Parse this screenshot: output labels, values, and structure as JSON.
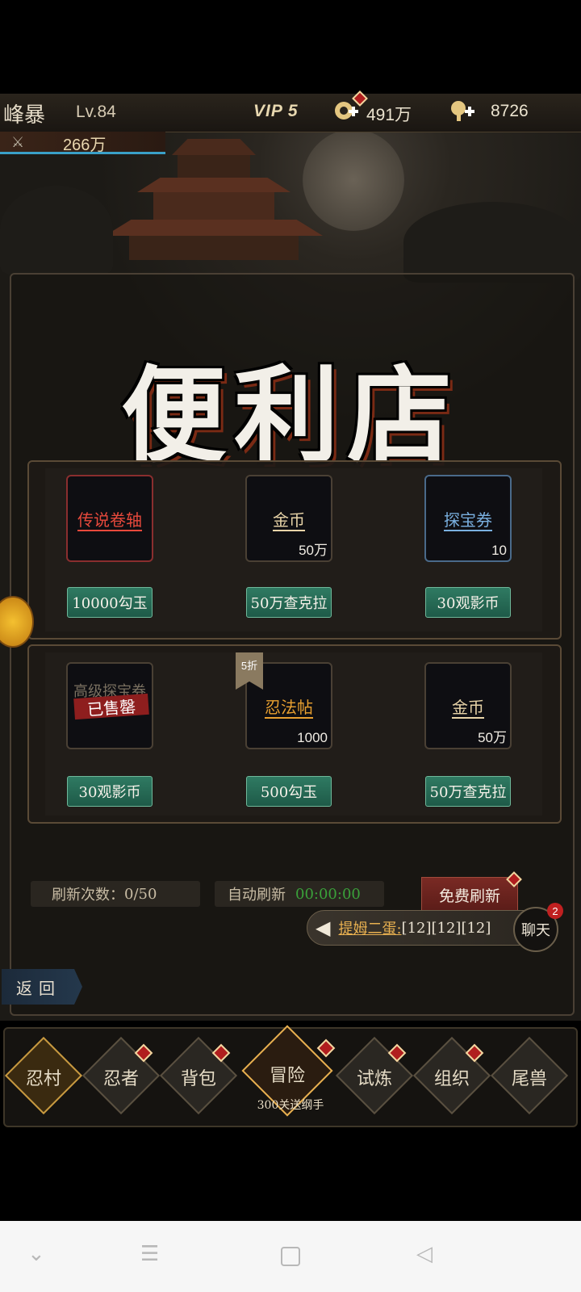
{
  "player": {
    "name": "峰暴",
    "level": "Lv.84",
    "vip": "VIP 5",
    "power": "266万",
    "currency_1": "491万",
    "currency_2": "8726"
  },
  "shop": {
    "title": "便利店",
    "items": [
      {
        "name": "传说卷轴",
        "qty": "",
        "price": "10000勾玉",
        "name_color": "#e8493c",
        "rarity": "red"
      },
      {
        "name": "金币",
        "qty": "50万",
        "price": "50万查克拉",
        "name_color": "#e8d4a8",
        "rarity": "normal"
      },
      {
        "name": "探宝券",
        "qty": "10",
        "price": "30观影币",
        "name_color": "#7ab0e0",
        "rarity": "blue"
      },
      {
        "name": "高级探宝券",
        "qty": "",
        "price": "30观影币",
        "name_color": "#7a7060",
        "rarity": "normal",
        "sold_label": "已售罄"
      },
      {
        "name": "忍法帖",
        "qty": "1000",
        "price": "500勾玉",
        "name_color": "#e8a030",
        "rarity": "normal",
        "discount": "5折"
      },
      {
        "name": "金币",
        "qty": "50万",
        "price": "50万查克拉",
        "name_color": "#e8d4a8",
        "rarity": "normal"
      }
    ],
    "refresh_count_label": "刷新次数：",
    "refresh_count_value": "0/50",
    "auto_refresh_label": "自动刷新",
    "auto_refresh_time": "00:00:00",
    "free_refresh": "免费刷新"
  },
  "chat": {
    "sender": "提姆二蛋:",
    "message": "[12][12][12]",
    "button": "聊天",
    "unread": "2"
  },
  "back_label": "返回",
  "nav": {
    "tabs": [
      {
        "label": "忍村",
        "dot": false
      },
      {
        "label": "忍者",
        "dot": true
      },
      {
        "label": "背包",
        "dot": true
      },
      {
        "label": "冒险",
        "dot": true
      },
      {
        "label": "试炼",
        "dot": true
      },
      {
        "label": "组织",
        "dot": true
      },
      {
        "label": "尾兽",
        "dot": false
      }
    ],
    "adventure_sub": "300关送纲手"
  },
  "colors": {
    "accent_gold": "#e8b050",
    "price_green": "#2f7a62",
    "time_green": "#3aa03a",
    "badge_red": "#b01e1e"
  }
}
